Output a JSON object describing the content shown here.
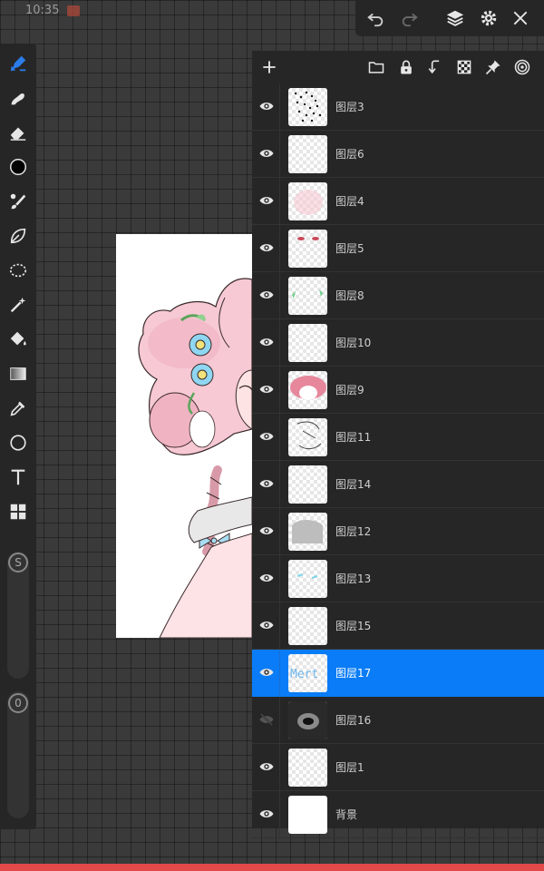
{
  "status": {
    "time": "10:35"
  },
  "topbar": {
    "icons": [
      "undo-icon",
      "redo-icon",
      "layers-icon",
      "settings-icon",
      "close-icon"
    ]
  },
  "toolbar": {
    "tools": [
      "brush",
      "smudge",
      "eraser",
      "color",
      "paint-brush",
      "pen",
      "lasso",
      "magic-wand",
      "fill",
      "gradient",
      "eyedropper",
      "shape",
      "text",
      "grid"
    ],
    "size_label": "S",
    "opacity_label": "0",
    "color_value": "#000000"
  },
  "layers_panel": {
    "header_icons": [
      "add-icon",
      "folder-icon",
      "lock-icon",
      "merge-down-icon",
      "transparency-icon",
      "pin-icon",
      "spiral-icon"
    ],
    "layers": [
      {
        "name": "图层3",
        "visible": true,
        "selected": false,
        "thumb": "dots"
      },
      {
        "name": "图层6",
        "visible": true,
        "selected": false,
        "thumb": "empty"
      },
      {
        "name": "图层4",
        "visible": true,
        "selected": false,
        "thumb": "pink-light"
      },
      {
        "name": "图层5",
        "visible": true,
        "selected": false,
        "thumb": "eyes"
      },
      {
        "name": "图层8",
        "visible": true,
        "selected": false,
        "thumb": "green"
      },
      {
        "name": "图层10",
        "visible": true,
        "selected": false,
        "thumb": "empty"
      },
      {
        "name": "图层9",
        "visible": true,
        "selected": false,
        "thumb": "pink-hair"
      },
      {
        "name": "图层11",
        "visible": true,
        "selected": false,
        "thumb": "sketch"
      },
      {
        "name": "图层14",
        "visible": true,
        "selected": false,
        "thumb": "empty"
      },
      {
        "name": "图层12",
        "visible": true,
        "selected": false,
        "thumb": "gray"
      },
      {
        "name": "图层13",
        "visible": true,
        "selected": false,
        "thumb": "cyan"
      },
      {
        "name": "图层15",
        "visible": true,
        "selected": false,
        "thumb": "empty"
      },
      {
        "name": "图层17",
        "visible": true,
        "selected": true,
        "thumb": "text",
        "thumb_text": "Mert"
      },
      {
        "name": "图层16",
        "visible": false,
        "selected": false,
        "thumb": "dark"
      },
      {
        "name": "图层1",
        "visible": true,
        "selected": false,
        "thumb": "empty"
      },
      {
        "name": "背景",
        "visible": true,
        "selected": false,
        "thumb": "white"
      }
    ]
  },
  "colors": {
    "accent": "#0a7cf7",
    "panel": "#262626",
    "bottom_bar": "#e24a4a"
  }
}
